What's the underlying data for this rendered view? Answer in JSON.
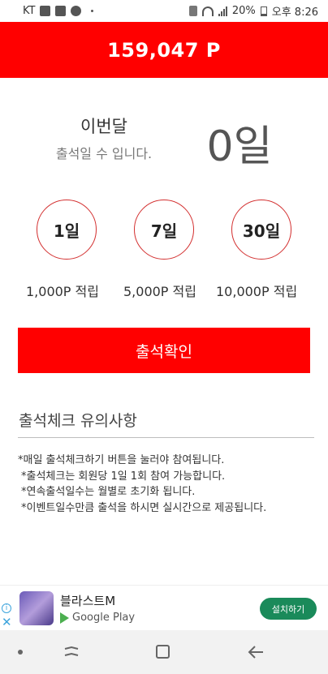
{
  "status_bar": {
    "carrier": "KT",
    "battery": "20%",
    "time": "오후 8:26"
  },
  "header": {
    "points": "159,047 P"
  },
  "attendance": {
    "month_title": "이번달",
    "month_subtitle": "출석일 수 입니다.",
    "days_value": "0일"
  },
  "rewards": [
    {
      "day": "1일",
      "label": "1,000P 적립"
    },
    {
      "day": "7일",
      "label": "5,000P 적립"
    },
    {
      "day": "30일",
      "label": "10,000P 적립"
    }
  ],
  "checkin_button": "출석확인",
  "notice": {
    "title": "출석체크 유의사항",
    "lines": [
      "*매일 출석체크하기 버튼을 눌러야 참여됩니다.",
      "*출석체크는 회원당 1일 1회 참여 가능합니다.",
      "*연속출석일수는 월별로 초기화 됩니다.",
      "*이벤트일수만큼 출석을 하시면 실시간으로 제공됩니다."
    ]
  },
  "ad": {
    "app_name": "블라스트M",
    "store": "Google Play",
    "install_button": "설치하기"
  },
  "colors": {
    "accent": "#ff0000",
    "circle_border": "#d32f2f",
    "install_button": "#1a8a5a"
  }
}
